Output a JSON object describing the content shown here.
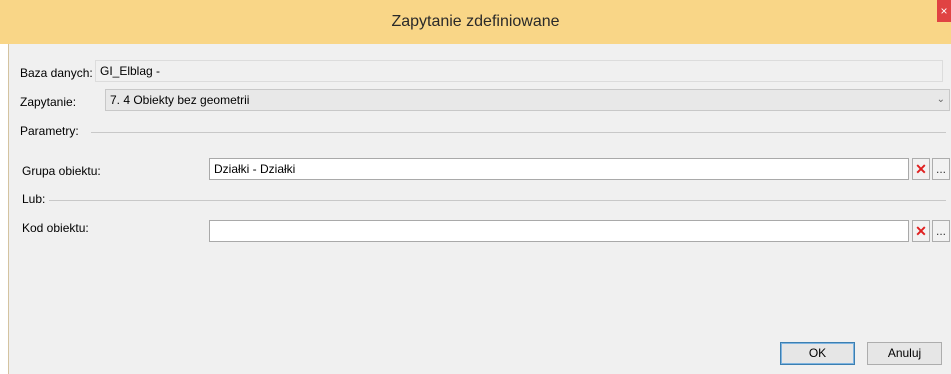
{
  "window": {
    "title": "Zapytanie zdefiniowane",
    "close_glyph": "×"
  },
  "form": {
    "database_label": "Baza danych:",
    "database_value": "GI_Elblag -",
    "query_label": "Zapytanie:",
    "query_value": "7. 4 Obiekty bez geometrii",
    "parameters_label": "Parametry:",
    "object_group_label": "Grupa obiektu:",
    "object_group_value": "Działki - Działki",
    "or_label": "Lub:",
    "object_code_label": "Kod obiektu:",
    "object_code_value": ""
  },
  "icons": {
    "chevron": "⌄",
    "clear": "✕",
    "browse": "..."
  },
  "buttons": {
    "ok_label": "OK",
    "cancel_label": "Anuluj"
  },
  "colors": {
    "titlebar": "#f9d687",
    "close": "#e04343",
    "client_bg": "#f0f0f0",
    "clear_icon": "#e02020"
  }
}
